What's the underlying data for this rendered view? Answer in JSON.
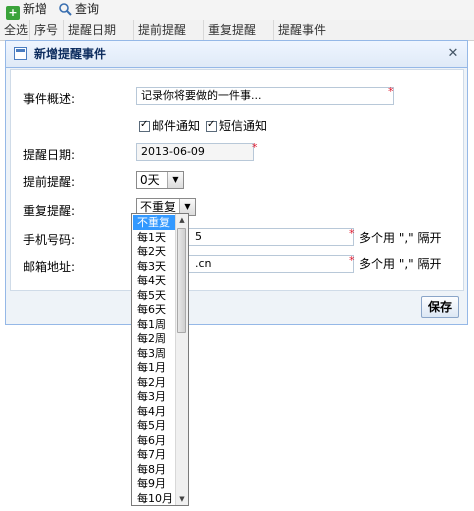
{
  "toolbar": {
    "add_label": "新增",
    "query_label": "查询"
  },
  "grid": {
    "columns": [
      "全选",
      "序号",
      "提醒日期",
      "提前提醒",
      "重复提醒",
      "提醒事件"
    ]
  },
  "dialog": {
    "title": "新增提醒事件",
    "event_label": "事件概述:",
    "event_placeholder": "记录你将要做的一件事...",
    "email_notify_label": "邮件通知",
    "sms_notify_label": "短信通知",
    "date_label": "提醒日期:",
    "date_value": "2013-06-09",
    "advance_label": "提前提醒:",
    "advance_value": "0天",
    "repeat_label": "重复提醒:",
    "repeat_value": "不重复",
    "phone_label": "手机号码:",
    "phone_value": "5",
    "email_label": "邮箱地址:",
    "email_value": ".cn",
    "multi_hint": "多个用 \",\" 隔开",
    "save_label": "保存"
  },
  "dropdown": {
    "options": [
      "不重复",
      "每1天",
      "每2天",
      "每3天",
      "每4天",
      "每5天",
      "每6天",
      "每1周",
      "每2周",
      "每3周",
      "每1月",
      "每2月",
      "每3月",
      "每4月",
      "每5月",
      "每6月",
      "每7月",
      "每8月",
      "每9月",
      "每10月"
    ],
    "selected_index": 0
  },
  "colors": {
    "accent": "#95b8e7",
    "selected": "#3399ff",
    "required": "#e0182d"
  }
}
